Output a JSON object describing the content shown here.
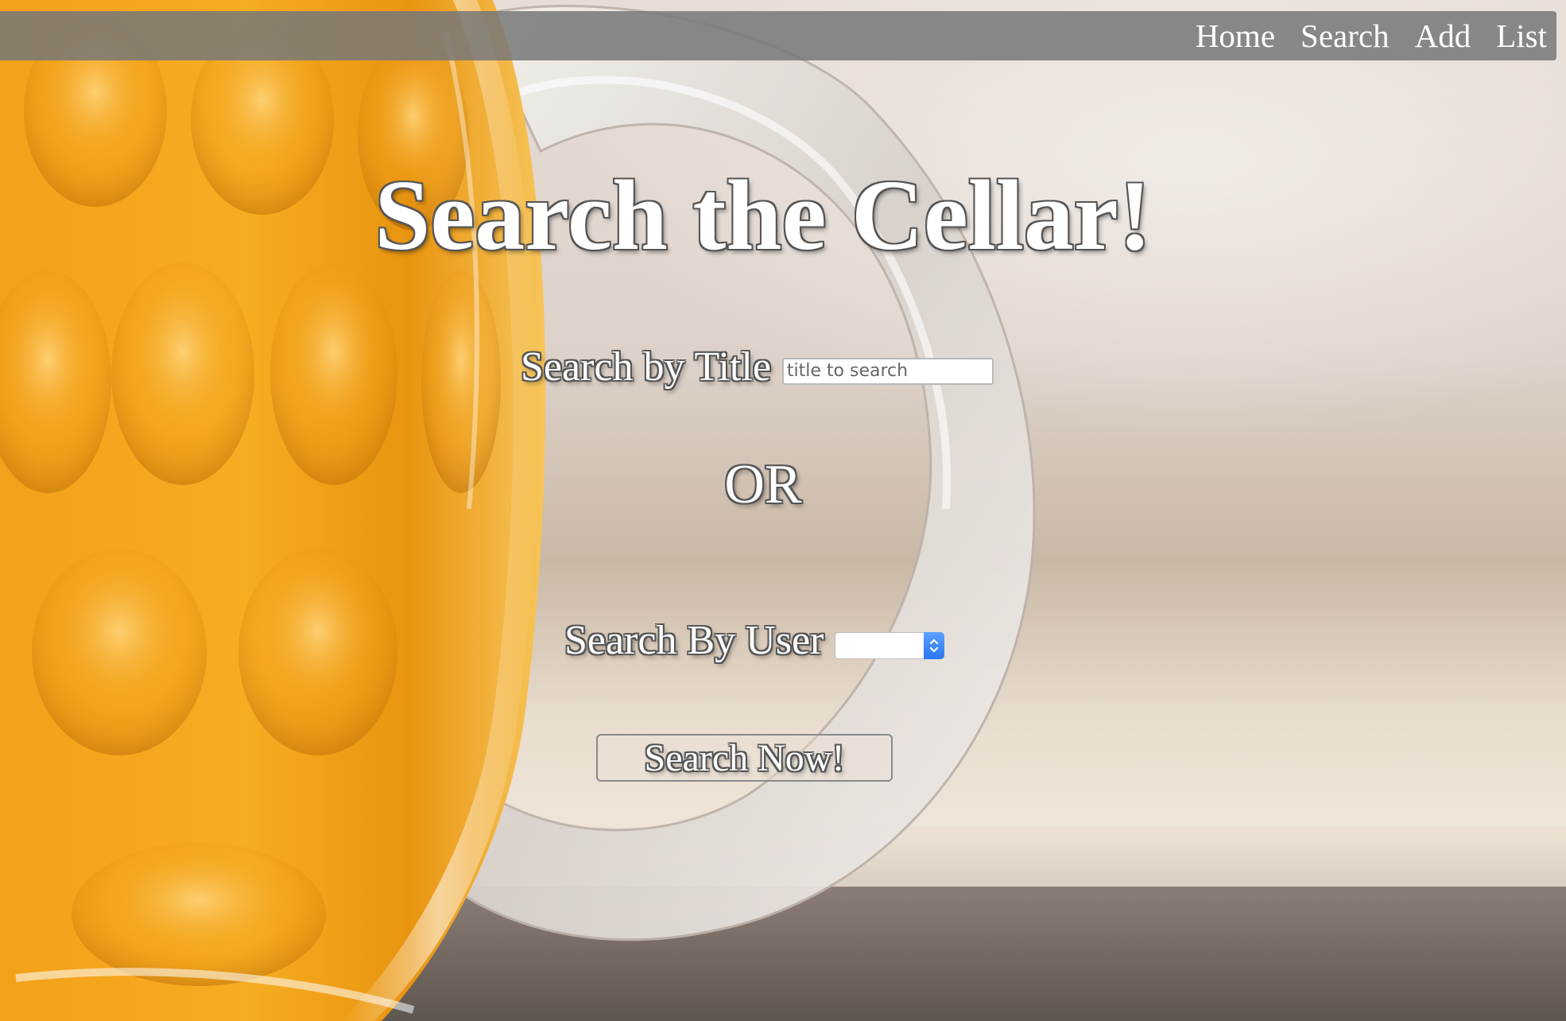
{
  "nav": {
    "home": "Home",
    "search": "Search",
    "add": "Add",
    "list": "List"
  },
  "page": {
    "title": "Search the Cellar!"
  },
  "search_title": {
    "label": "Search by Title",
    "placeholder": "title to search",
    "value": ""
  },
  "separator": "OR",
  "search_user": {
    "label": "Search By User",
    "selected": ""
  },
  "submit": {
    "label": "Search Now!"
  },
  "colors": {
    "navbar": "#7a7a7a",
    "text": "#ffffff",
    "select_accent": "#2b77f2",
    "beer": "#f0a21a"
  },
  "icons": {
    "select_arrows": "up-down-chevron-icon",
    "background": "beer-mug-photo"
  }
}
